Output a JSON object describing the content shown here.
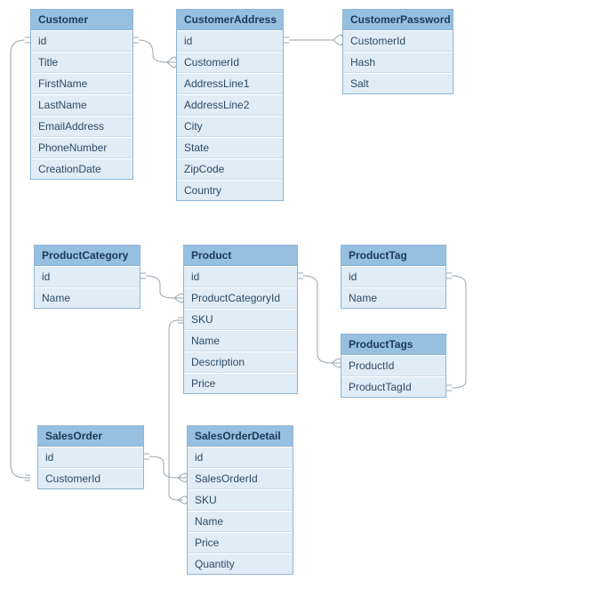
{
  "tables": {
    "customer": {
      "name": "Customer",
      "fields": [
        "id",
        "Title",
        "FirstName",
        "LastName",
        "EmailAddress",
        "PhoneNumber",
        "CreationDate"
      ]
    },
    "customerAddress": {
      "name": "CustomerAddress",
      "fields": [
        "id",
        "CustomerId",
        "AddressLine1",
        "AddressLine2",
        "City",
        "State",
        "ZipCode",
        "Country"
      ]
    },
    "customerPassword": {
      "name": "CustomerPassword",
      "fields": [
        "CustomerId",
        "Hash",
        "Salt"
      ]
    },
    "productCategory": {
      "name": "ProductCategory",
      "fields": [
        "id",
        "Name"
      ]
    },
    "product": {
      "name": "Product",
      "fields": [
        "id",
        "ProductCategoryId",
        "SKU",
        "Name",
        "Description",
        "Price"
      ]
    },
    "productTag": {
      "name": "ProductTag",
      "fields": [
        "id",
        "Name"
      ]
    },
    "productTags": {
      "name": "ProductTags",
      "fields": [
        "ProductId",
        "ProductTagId"
      ]
    },
    "salesOrder": {
      "name": "SalesOrder",
      "fields": [
        "id",
        "CustomerId"
      ]
    },
    "salesOrderDetail": {
      "name": "SalesOrderDetail",
      "fields": [
        "id",
        "SalesOrderId",
        "SKU",
        "Name",
        "Price",
        "Quantity"
      ]
    }
  }
}
